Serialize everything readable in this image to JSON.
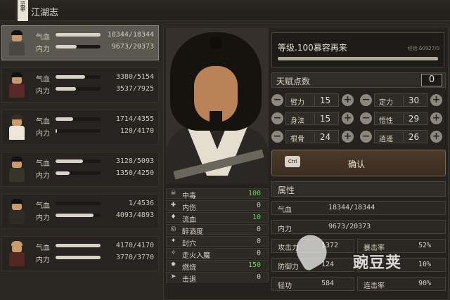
{
  "window": {
    "title": "江湖志",
    "menu_tab": "菜单"
  },
  "roster": [
    {
      "selected": true,
      "hp_label": "气血",
      "mp_label": "内力",
      "hp": "18344/18344",
      "mp": "9673/20373",
      "hp_ratio": 1.0,
      "mp_ratio": 0.47
    },
    {
      "selected": false,
      "hp_label": "气血",
      "mp_label": "内力",
      "hp": "3380/5154",
      "mp": "3537/7925",
      "hp_ratio": 0.656,
      "mp_ratio": 0.446
    },
    {
      "selected": false,
      "hp_label": "气血",
      "mp_label": "内力",
      "hp": "1714/4355",
      "mp": "120/4170",
      "hp_ratio": 0.394,
      "mp_ratio": 0.029
    },
    {
      "selected": false,
      "hp_label": "气血",
      "mp_label": "内力",
      "hp": "3128/5093",
      "mp": "1350/4250",
      "hp_ratio": 0.614,
      "mp_ratio": 0.318
    },
    {
      "selected": false,
      "hp_label": "气血",
      "mp_label": "内力",
      "hp": "1/4536",
      "mp": "4093/4893",
      "hp_ratio": 0.0,
      "mp_ratio": 0.836
    },
    {
      "selected": false,
      "hp_label": "气血",
      "mp_label": "内力",
      "hp": "4170/4170",
      "mp": "3770/3770",
      "hp_ratio": 1.0,
      "mp_ratio": 1.0
    }
  ],
  "status_effects": [
    {
      "icon": "poison-icon",
      "glyph": "☠",
      "label": "中毒",
      "value": "100",
      "highlight": true
    },
    {
      "icon": "injury-icon",
      "glyph": "✚",
      "label": "内伤",
      "value": "0",
      "highlight": false
    },
    {
      "icon": "bleed-icon",
      "glyph": "♦",
      "label": "流血",
      "value": "10",
      "highlight": true
    },
    {
      "icon": "drunk-icon",
      "glyph": "◎",
      "label": "醉酒度",
      "value": "0",
      "highlight": false
    },
    {
      "icon": "seal-icon",
      "glyph": "✦",
      "label": "封穴",
      "value": "0",
      "highlight": false
    },
    {
      "icon": "qi-deviation-icon",
      "glyph": "✧",
      "label": "走火入魔",
      "value": "0",
      "highlight": false
    },
    {
      "icon": "burn-icon",
      "glyph": "✹",
      "label": "燃烧",
      "value": "150",
      "highlight": true
    },
    {
      "icon": "knockback-icon",
      "glyph": "➤",
      "label": "击退",
      "value": "0",
      "highlight": false
    }
  ],
  "level": {
    "text": "等级.100慕容再来",
    "exp_text": "经验.60927/0",
    "exp_ratio": 1.0
  },
  "talent": {
    "label": "天赋点数",
    "value": "0"
  },
  "attributes": [
    {
      "label": "臂力",
      "value": "15"
    },
    {
      "label": "定力",
      "value": "30"
    },
    {
      "label": "身法",
      "value": "15"
    },
    {
      "label": "悟性",
      "value": "29"
    },
    {
      "label": "根骨",
      "value": "24"
    },
    {
      "label": "逍遥",
      "value": "26"
    }
  ],
  "confirm": {
    "key": "Ctrl",
    "label": "确认"
  },
  "properties": {
    "header": "属性",
    "hp": {
      "label": "气血",
      "value": "18344/18344"
    },
    "mp": {
      "label": "内力",
      "value": "9673/20373"
    },
    "rows": [
      {
        "left_label": "攻击力",
        "left_value": "1372",
        "right_label": "暴击率",
        "right_value": "52%"
      },
      {
        "left_label": "防御力",
        "left_value": "124",
        "right_label": "",
        "right_value": "10%"
      },
      {
        "left_label": "轻功",
        "left_value": "584",
        "right_label": "连击率",
        "right_value": "90%"
      }
    ]
  },
  "watermark": {
    "text": "豌豆荚"
  },
  "colors": {
    "highlight": "#67d357",
    "bar": "#d9d3c5",
    "panel": "#24211e"
  }
}
